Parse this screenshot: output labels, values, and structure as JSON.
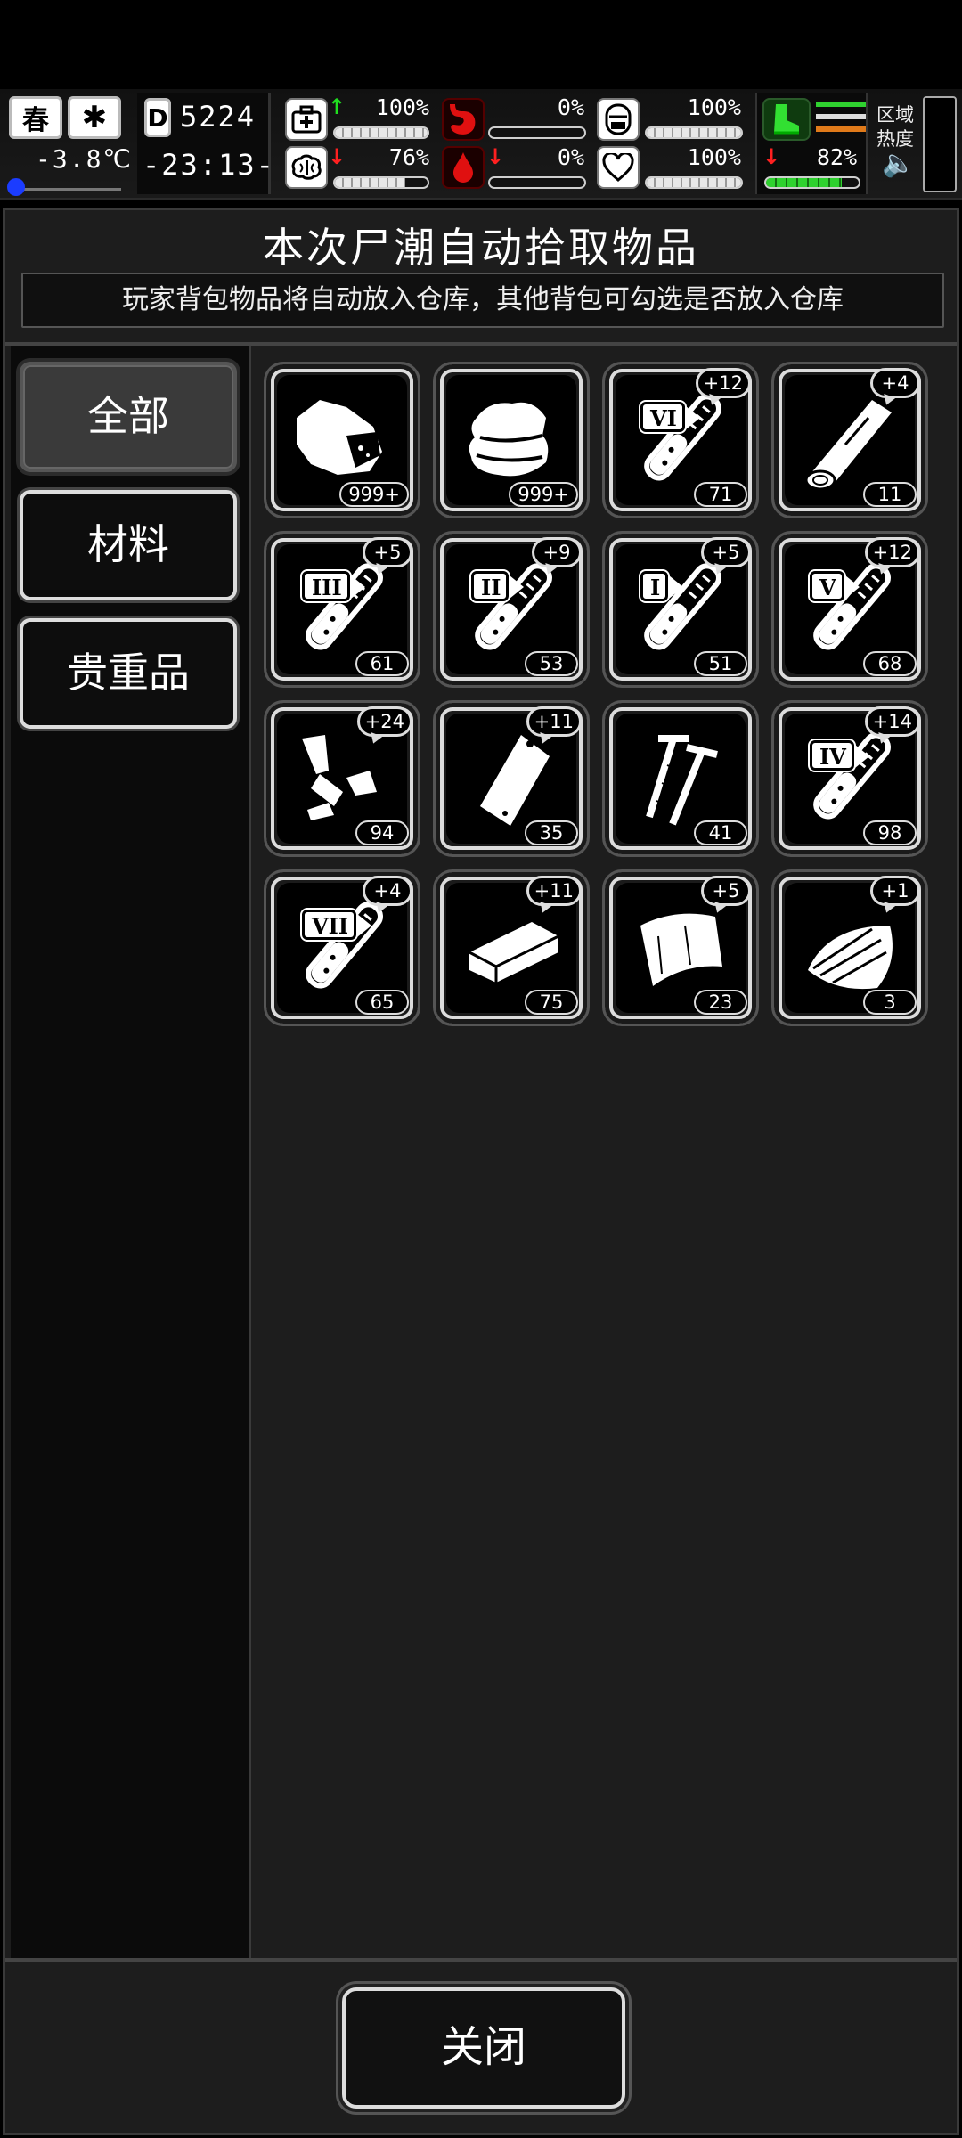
{
  "hud": {
    "season": "春",
    "temperature": "-3.8℃",
    "day_prefix": "D",
    "day": "5224",
    "clock": "-23:13-",
    "region_label_1": "区域",
    "region_label_2": "热度",
    "stats": [
      {
        "name": "health",
        "icon": "medkit-icon",
        "value": "100%",
        "trend": "up",
        "level": 1.0
      },
      {
        "name": "hunger",
        "icon": "stomach-icon",
        "value": "0%",
        "trend": "none",
        "level": 0.0
      },
      {
        "name": "equipment",
        "icon": "armor-icon",
        "value": "100%",
        "trend": "none",
        "level": 1.0
      },
      {
        "name": "sanity",
        "icon": "brain-icon",
        "value": "76%",
        "trend": "down",
        "level": 0.76
      },
      {
        "name": "thirst",
        "icon": "water-drop-icon",
        "value": "0%",
        "trend": "down",
        "level": 0.0
      },
      {
        "name": "mood",
        "icon": "heart-icon",
        "value": "100%",
        "trend": "none",
        "level": 1.0
      },
      {
        "name": "stamina",
        "icon": "boot-icon",
        "value": "82%",
        "trend": "down",
        "level": 0.82
      }
    ],
    "colors": {
      "up": "#20e020",
      "down": "#ff2020",
      "stamina_bar": "#2fd12f"
    }
  },
  "panel": {
    "title": "本次尸潮自动拾取物品",
    "subtitle": "玩家背包物品将自动放入仓库，其他背包可勾选是否放入仓库"
  },
  "tabs": [
    {
      "label": "全部",
      "active": true
    },
    {
      "label": "材料",
      "active": false
    },
    {
      "label": "贵重品",
      "active": false
    }
  ],
  "items": [
    {
      "icon": "meat-icon",
      "count": "999+",
      "bonus": ""
    },
    {
      "icon": "cloth-icon",
      "count": "999+",
      "bonus": ""
    },
    {
      "icon": "potion-tube-icon",
      "roman": "VI",
      "count": "71",
      "bonus": "+12"
    },
    {
      "icon": "wood-log-icon",
      "count": "11",
      "bonus": "+4"
    },
    {
      "icon": "potion-tube-icon",
      "roman": "III",
      "count": "61",
      "bonus": "+5"
    },
    {
      "icon": "potion-tube-icon",
      "roman": "II",
      "count": "53",
      "bonus": "+9"
    },
    {
      "icon": "potion-tube-icon",
      "roman": "I",
      "count": "51",
      "bonus": "+5"
    },
    {
      "icon": "potion-tube-icon",
      "roman": "V",
      "count": "68",
      "bonus": "+12"
    },
    {
      "icon": "scrap-parts-icon",
      "count": "94",
      "bonus": "+24"
    },
    {
      "icon": "plastic-bag-icon",
      "count": "35",
      "bonus": "+11"
    },
    {
      "icon": "nails-icon",
      "count": "41",
      "bonus": ""
    },
    {
      "icon": "potion-tube-icon",
      "roman": "IV",
      "count": "98",
      "bonus": "+14"
    },
    {
      "icon": "potion-tube-icon",
      "roman": "VII",
      "count": "65",
      "bonus": "+4"
    },
    {
      "icon": "plank-icon",
      "count": "75",
      "bonus": "+11"
    },
    {
      "icon": "leather-icon",
      "count": "23",
      "bonus": "+5"
    },
    {
      "icon": "wood-scraps-icon",
      "count": "3",
      "bonus": "+1"
    }
  ],
  "footer": {
    "close_label": "关闭"
  }
}
